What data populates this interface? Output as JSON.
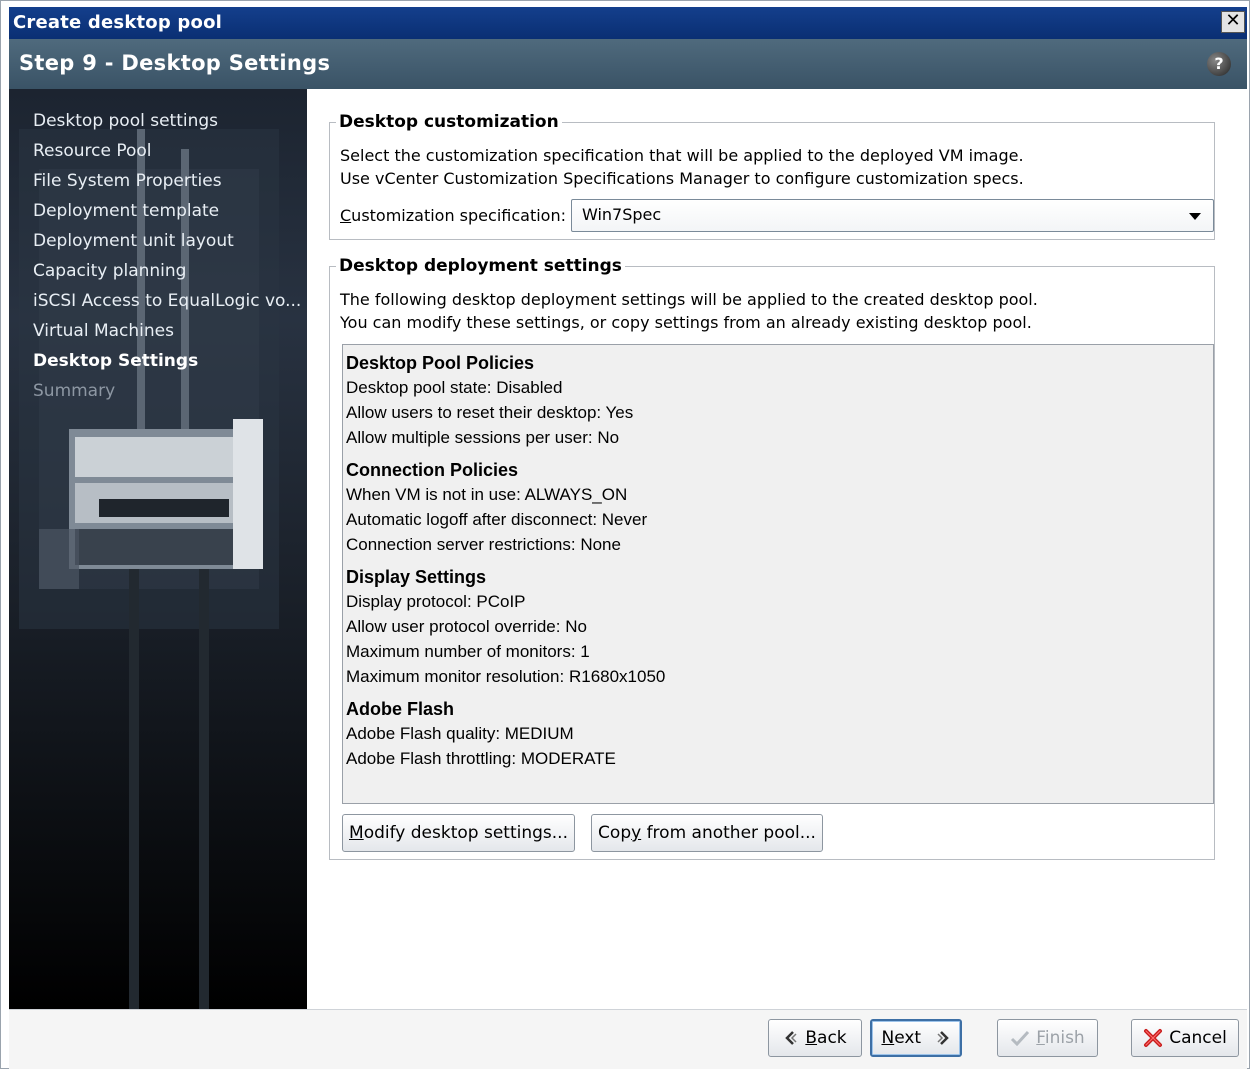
{
  "window": {
    "title": "Create desktop pool",
    "close_glyph": "✕"
  },
  "step": {
    "title": "Step 9 - Desktop Settings",
    "help_glyph": "?"
  },
  "sidebar": {
    "items": [
      {
        "label": "Desktop pool settings",
        "state": "done"
      },
      {
        "label": "Resource Pool",
        "state": "done"
      },
      {
        "label": "File System Properties",
        "state": "done"
      },
      {
        "label": "Deployment template",
        "state": "done"
      },
      {
        "label": "Deployment unit layout",
        "state": "done"
      },
      {
        "label": "Capacity planning",
        "state": "done"
      },
      {
        "label": "iSCSI Access to EqualLogic vo...",
        "state": "done"
      },
      {
        "label": "Virtual Machines",
        "state": "done"
      },
      {
        "label": "Desktop Settings",
        "state": "active"
      },
      {
        "label": "Summary",
        "state": "pending"
      }
    ]
  },
  "customization": {
    "legend": "Desktop customization",
    "desc_line1": "Select the customization specification that will be applied to the deployed VM image.",
    "desc_line2": "Use vCenter Customization Specifications Manager to configure customization specs.",
    "spec_label_accel": "C",
    "spec_label_rest": "ustomization specification:",
    "spec_value": "Win7Spec"
  },
  "deployment": {
    "legend": "Desktop deployment settings",
    "desc_line1": "The following desktop deployment settings will be applied to the created desktop pool.",
    "desc_line2": "You can modify these settings, or copy settings from an already existing desktop pool.",
    "sections": [
      {
        "title": "Desktop Pool Policies",
        "lines": [
          "Desktop pool state:  Disabled",
          "Allow users to reset their desktop:  Yes",
          "Allow multiple sessions per user:  No"
        ]
      },
      {
        "title": "Connection Policies",
        "lines": [
          "When VM is not in use:  ALWAYS_ON",
          "Automatic logoff after disconnect:  Never",
          "Connection server restrictions:  None"
        ]
      },
      {
        "title": "Display Settings",
        "lines": [
          "Display protocol:  PCoIP",
          "Allow user protocol override:  No",
          "Maximum number of monitors:  1",
          "Maximum monitor resolution:  R1680x1050"
        ]
      },
      {
        "title": "Adobe Flash",
        "lines": [
          "Adobe Flash quality:  MEDIUM",
          "Adobe Flash throttling:  MODERATE"
        ]
      }
    ],
    "modify_accel": "M",
    "modify_rest": "odify desktop settings...",
    "copy_pre": "Cop",
    "copy_accel": "y",
    "copy_rest": " from another pool..."
  },
  "footer": {
    "back_accel": "B",
    "back_rest": "ack",
    "next_accel": "N",
    "next_rest": "ext",
    "finish_accel": "F",
    "finish_rest": "inish",
    "cancel_label": "Cancel"
  },
  "colors": {
    "title_bar": "#0a2f73",
    "step_bar": "#445d70",
    "sidebar": "#1a2029",
    "next_border": "#3d6fa5"
  },
  "icons": {
    "back": "chevron-left-icon",
    "next": "chevron-right-icon",
    "finish": "check-icon",
    "cancel": "red-x-icon",
    "help": "help-icon"
  }
}
